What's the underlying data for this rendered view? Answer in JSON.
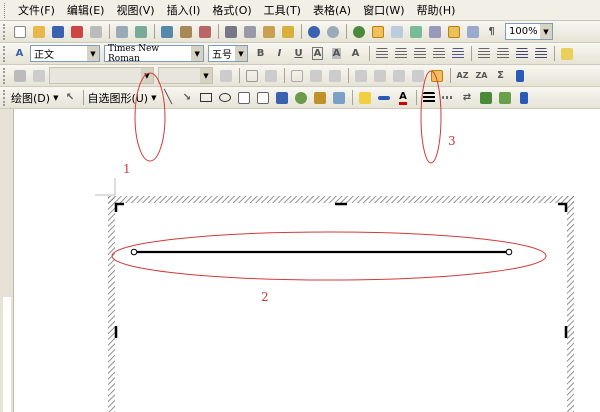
{
  "menu": {
    "items": [
      "文件(F)",
      "编辑(E)",
      "视图(V)",
      "插入(I)",
      "格式(O)",
      "工具(T)",
      "表格(A)",
      "窗口(W)",
      "帮助(H)"
    ]
  },
  "standard_toolbar": {
    "zoom": "100%"
  },
  "format_toolbar": {
    "style": "正文",
    "font": "Times New Roman",
    "size": "五号",
    "bold": "B",
    "italic": "I",
    "underline": "U",
    "char_border": "A",
    "char_shading": "A",
    "scale": "A"
  },
  "drawing_toolbar": {
    "draw_label": "绘图(D)",
    "autoshapes_label": "自选图形(U)",
    "font_color": "A"
  },
  "annotations": {
    "label1": "1",
    "label2": "2",
    "label3": "3"
  },
  "colors": {
    "annotation_red": "#d13a3a",
    "toolbar_bg": "#ece9d8"
  }
}
